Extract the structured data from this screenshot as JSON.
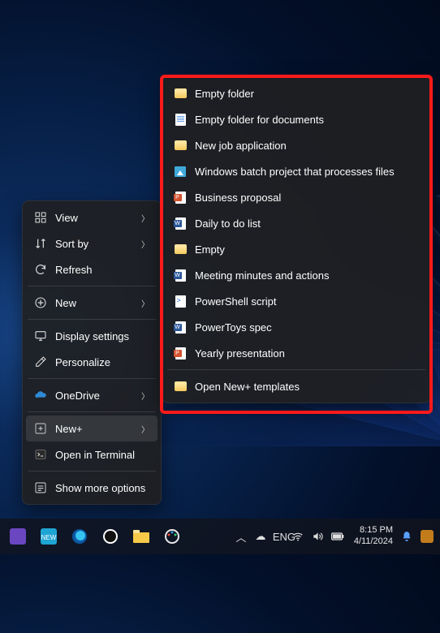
{
  "context_menu": {
    "items": [
      {
        "icon": "view-icon",
        "label": "View",
        "submenu": true
      },
      {
        "icon": "sort-icon",
        "label": "Sort by",
        "submenu": true
      },
      {
        "icon": "refresh-icon",
        "label": "Refresh",
        "submenu": false
      },
      {
        "sep": true
      },
      {
        "icon": "new-icon",
        "label": "New",
        "submenu": true
      },
      {
        "sep": true
      },
      {
        "icon": "display-icon",
        "label": "Display settings",
        "submenu": false
      },
      {
        "icon": "personalize-icon",
        "label": "Personalize",
        "submenu": false
      },
      {
        "sep": true
      },
      {
        "icon": "onedrive-icon",
        "label": "OneDrive",
        "submenu": true
      },
      {
        "sep": true
      },
      {
        "icon": "newplus-icon",
        "label": "New+",
        "submenu": true,
        "hover": true
      },
      {
        "icon": "terminal-icon",
        "label": "Open in Terminal",
        "submenu": false
      },
      {
        "sep": true
      },
      {
        "icon": "more-icon",
        "label": "Show more options",
        "submenu": false
      }
    ]
  },
  "flyout": {
    "items": [
      {
        "icon": "folder",
        "label": "Empty folder"
      },
      {
        "icon": "wdoc",
        "label": "Empty folder for documents"
      },
      {
        "icon": "folder",
        "label": "New job application"
      },
      {
        "icon": "img",
        "label": "Windows batch project that processes files"
      },
      {
        "icon": "ppt",
        "label": "Business proposal"
      },
      {
        "icon": "word",
        "label": "Daily to do list"
      },
      {
        "icon": "folder",
        "label": "Empty"
      },
      {
        "icon": "word",
        "label": "Meeting minutes and actions"
      },
      {
        "icon": "ps",
        "label": "PowerShell script"
      },
      {
        "icon": "word",
        "label": "PowerToys spec"
      },
      {
        "icon": "ppt",
        "label": "Yearly presentation"
      },
      {
        "sep": true
      },
      {
        "icon": "folder",
        "label": "Open New+ templates"
      }
    ]
  },
  "taskbar": {
    "left_count": 7,
    "lang": "ENG",
    "clock_time": "8:15 PM",
    "clock_date": "4/11/2024"
  }
}
